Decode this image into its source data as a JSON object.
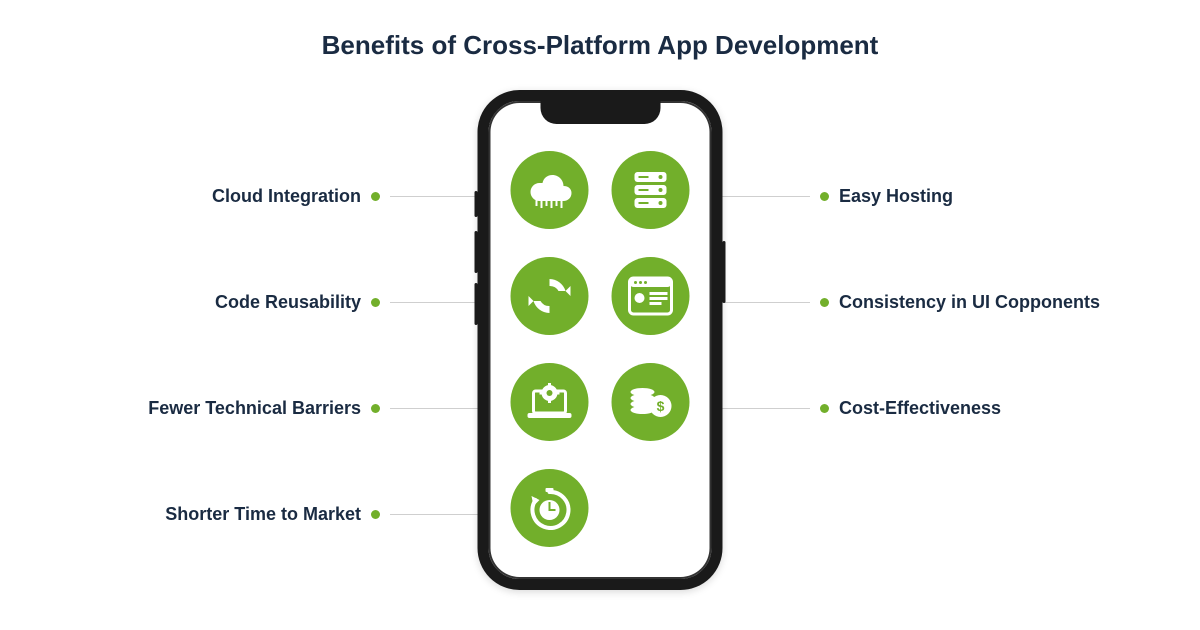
{
  "title": "Benefits of Cross-Platform App Development",
  "benefits": {
    "left": [
      {
        "label": "Cloud Integration",
        "icon": "cloud"
      },
      {
        "label": "Code Reusability",
        "icon": "recycle"
      },
      {
        "label": "Fewer Technical Barriers",
        "icon": "gear-laptop"
      },
      {
        "label": "Shorter Time to Market",
        "icon": "timer"
      }
    ],
    "right": [
      {
        "label": "Easy Hosting",
        "icon": "server"
      },
      {
        "label": "Consistency in UI Copponents",
        "icon": "dashboard"
      },
      {
        "label": "Cost-Effectiveness",
        "icon": "coins"
      }
    ]
  },
  "colors": {
    "accent": "#72af2b",
    "text": "#1a2b42"
  }
}
